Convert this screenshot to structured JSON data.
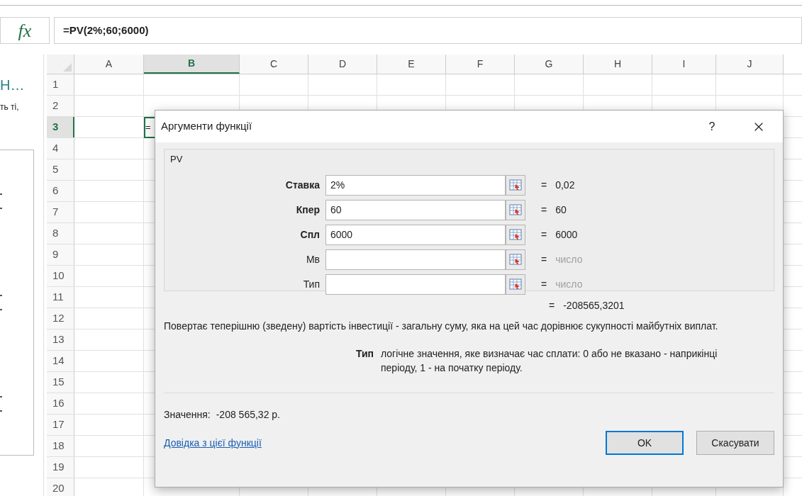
{
  "formula_bar": {
    "function_button": "fx",
    "formula": "=PV(2%;60;6000)"
  },
  "side_panel": {
    "heading": "Н…",
    "text": "ть ті,"
  },
  "grid": {
    "columns": [
      {
        "label": "A",
        "selected": false
      },
      {
        "label": "B",
        "selected": true
      },
      {
        "label": "C",
        "selected": false
      },
      {
        "label": "D",
        "selected": false
      },
      {
        "label": "E",
        "selected": false
      },
      {
        "label": "F",
        "selected": false
      },
      {
        "label": "G",
        "selected": false
      },
      {
        "label": "H",
        "selected": false
      },
      {
        "label": "I",
        "selected": false
      },
      {
        "label": "J",
        "selected": false
      }
    ],
    "rows": [
      {
        "label": "1",
        "selected": false
      },
      {
        "label": "2",
        "selected": false
      },
      {
        "label": "3",
        "selected": true
      },
      {
        "label": "4",
        "selected": false
      },
      {
        "label": "5",
        "selected": false
      },
      {
        "label": "6",
        "selected": false
      },
      {
        "label": "7",
        "selected": false
      },
      {
        "label": "8",
        "selected": false
      },
      {
        "label": "9",
        "selected": false
      },
      {
        "label": "10",
        "selected": false
      },
      {
        "label": "11",
        "selected": false
      },
      {
        "label": "12",
        "selected": false
      },
      {
        "label": "13",
        "selected": false
      },
      {
        "label": "14",
        "selected": false
      },
      {
        "label": "15",
        "selected": false
      },
      {
        "label": "16",
        "selected": false
      },
      {
        "label": "17",
        "selected": false
      },
      {
        "label": "18",
        "selected": false
      },
      {
        "label": "19",
        "selected": false
      },
      {
        "label": "20",
        "selected": false
      }
    ],
    "active_cell_text": "="
  },
  "dialog": {
    "title": "Аргументи функції",
    "help": "?",
    "group_label": "PV",
    "arguments": [
      {
        "label": "Ставка",
        "required": true,
        "value": "2%",
        "equals": "=",
        "result": "0,02",
        "muted": false
      },
      {
        "label": "Кпер",
        "required": true,
        "value": "60",
        "equals": "=",
        "result": "60",
        "muted": false
      },
      {
        "label": "Спл",
        "required": true,
        "value": "6000",
        "equals": "=",
        "result": "6000",
        "muted": false
      },
      {
        "label": "Мв",
        "required": false,
        "equals": "=",
        "result": "число",
        "muted": true
      },
      {
        "label": "Тип",
        "required": false,
        "equals": "=",
        "result": "число",
        "muted": true
      }
    ],
    "formula_equals": "=",
    "formula_result": "-208565,3201",
    "description": "Повертає теперішню (зведену) вартість інвестиції - загальну суму, яка на цей час дорівнює сукупності майбутніх виплат.",
    "argument_help": {
      "name": "Тип",
      "text": "логічне значення, яке визначає час сплати: 0 або не вказано - наприкінці періоду, 1 - на початку періоду."
    },
    "value_label": "Значення:",
    "value": "-208 565,32 р.",
    "help_link": "Довідка з цієї функції",
    "buttons": [
      {
        "label": "OK",
        "default": true
      },
      {
        "label": "Скасувати",
        "default": false
      }
    ]
  }
}
